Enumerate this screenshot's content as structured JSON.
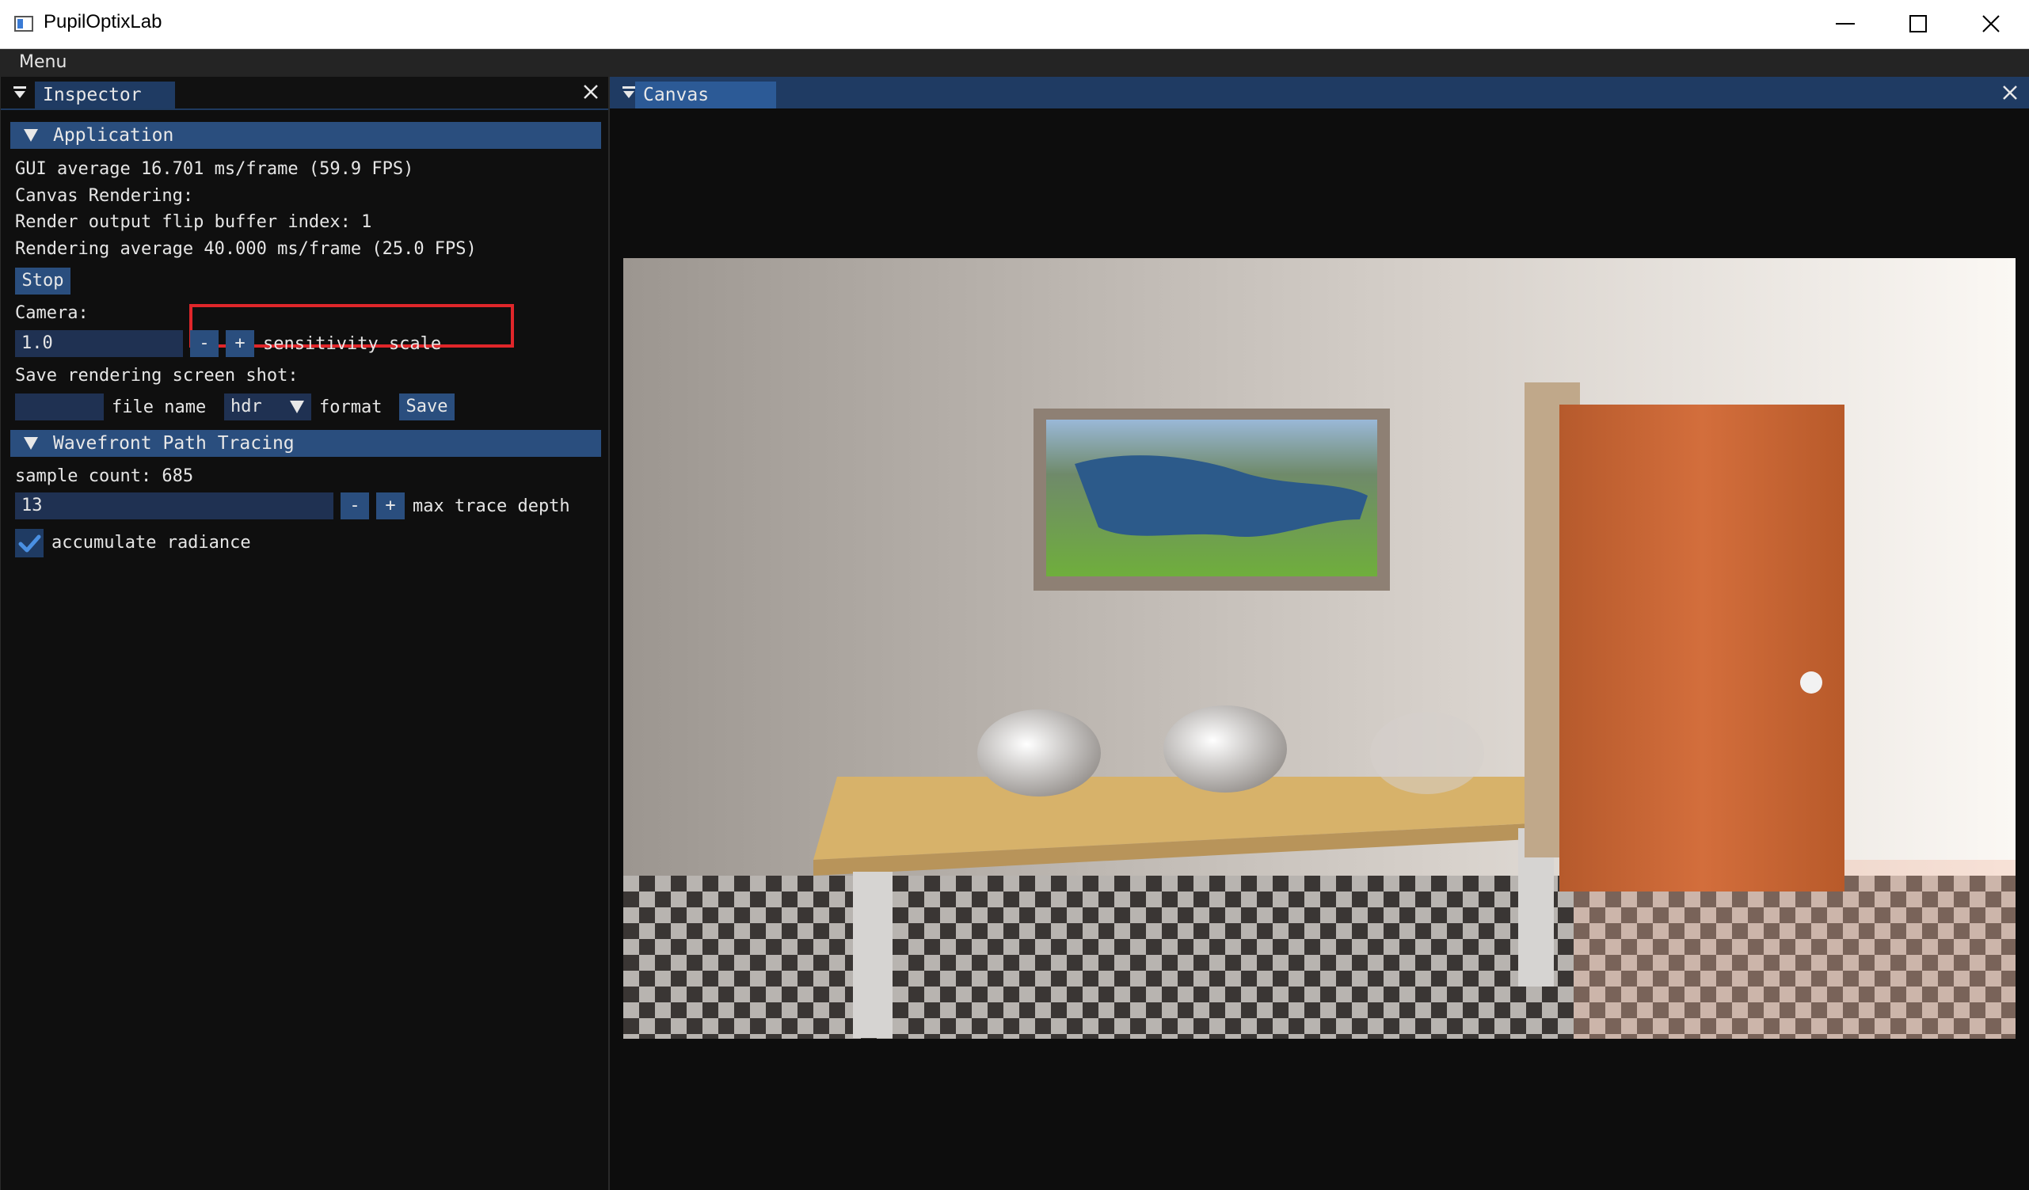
{
  "window": {
    "title": "PupilOptixLab"
  },
  "menubar": {
    "menu_label": "Menu"
  },
  "inspector": {
    "tab_label": "Inspector",
    "application": {
      "header": "Application",
      "gui_average": "GUI average 16.701 ms/frame (59.9 FPS)",
      "canvas_rendering": "Canvas Rendering:",
      "flip_buffer": "Render output flip buffer index: 1",
      "rendering_average": "Rendering average 40.000 ms/frame (25.0 FPS)",
      "stop_label": "Stop",
      "camera_label": "Camera:",
      "camera_value": "1.0",
      "minus": "-",
      "plus": "+",
      "sensitivity_label": "sensitivity scale",
      "screenshot_label": "Save rendering screen shot:",
      "file_name_value": "",
      "file_name_label": "file name",
      "format_value": "hdr",
      "format_label": "format",
      "save_label": "Save"
    },
    "wavefront": {
      "header": "Wavefront Path Tracing",
      "sample_count": "sample count: 685",
      "depth_value": "13",
      "minus": "-",
      "plus": "+",
      "depth_label": "max trace depth",
      "accumulate_label": "accumulate radiance",
      "accumulate_checked": true
    }
  },
  "canvas": {
    "tab_label": "Canvas"
  },
  "colors": {
    "accent": "#2a4e7e",
    "highlight": "#e0262a",
    "checkmark": "#4a90e2"
  }
}
